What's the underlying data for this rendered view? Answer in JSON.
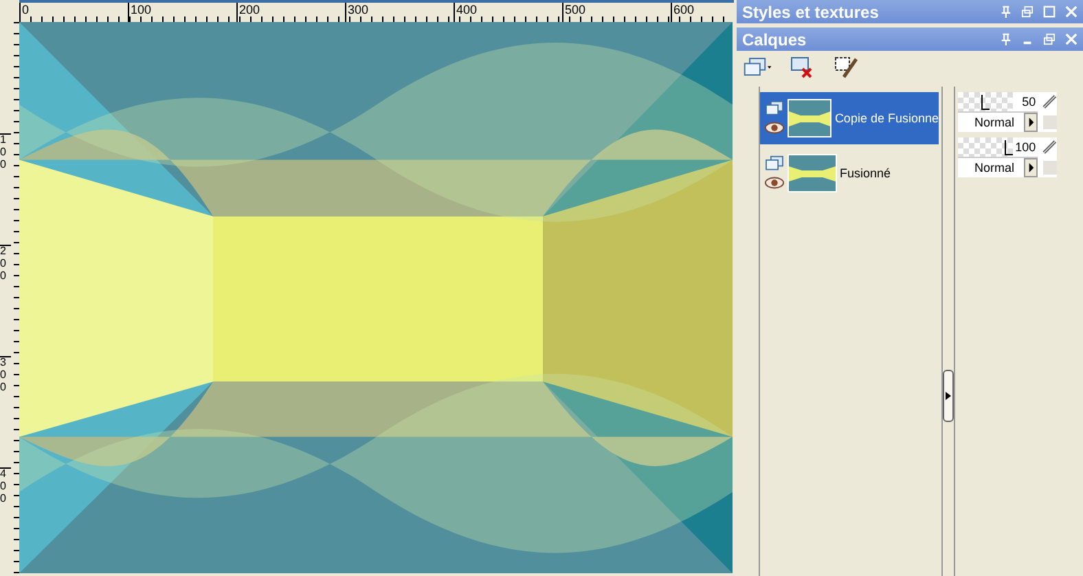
{
  "ruler_top": {
    "labels": [
      "0",
      "100",
      "200",
      "300",
      "400",
      "500",
      "600"
    ]
  },
  "ruler_left": {
    "labels": [
      "100",
      "200",
      "300",
      "400"
    ]
  },
  "panels": [
    {
      "title": "Styles et textures"
    },
    {
      "title": "Calques"
    }
  ],
  "layers": [
    {
      "name": "Copie de Fusionne",
      "selected": true,
      "opacity": "50",
      "level": 0.5,
      "blend": "Normal"
    },
    {
      "name": "Fusionné",
      "selected": false,
      "opacity": "100",
      "level": 1,
      "blend": "Normal"
    }
  ]
}
